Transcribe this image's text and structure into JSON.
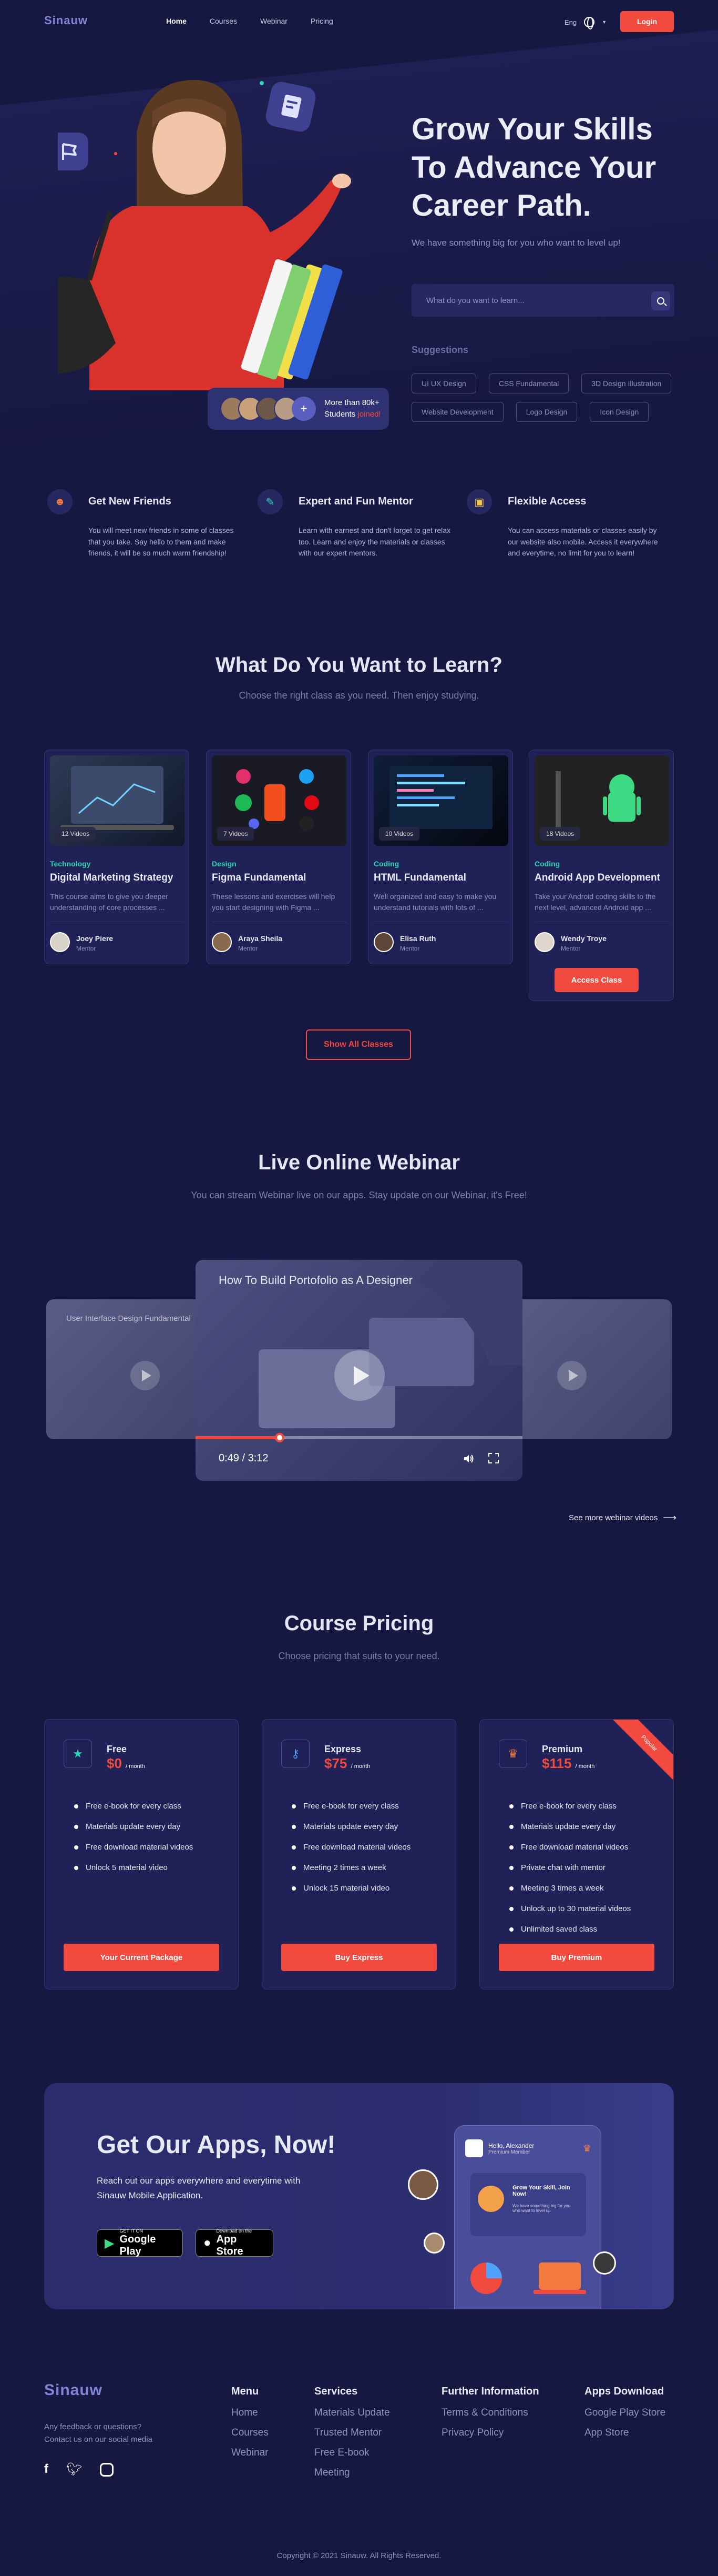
{
  "nav": {
    "logo": "Sinauw",
    "links": [
      {
        "label": "Home",
        "active": true
      },
      {
        "label": "Courses",
        "active": false
      },
      {
        "label": "Webinar",
        "active": false
      },
      {
        "label": "Pricing",
        "active": false
      }
    ],
    "lang": "Eng",
    "login_label": "Login"
  },
  "hero": {
    "title": "Grow Your Skills To Advance Your Career Path.",
    "subtitle": "We have something big for you who want to level up!",
    "search_placeholder": "What do you want to learn...",
    "suggestions_title": "Suggestions",
    "suggestions": [
      "UI UX Design",
      "CSS Fundamental",
      "3D Design Illustration",
      "Website Development",
      "Logo Design",
      "Icon Design"
    ],
    "students_text": "More than 80k+",
    "students_text2": "Students",
    "students_joined": "joined!",
    "students_plus": "+"
  },
  "features": [
    {
      "icon": "friends-icon",
      "title": "Get New Friends",
      "text": "You will meet new friends in some of classes that you take. Say hello to them and make friends, it will be so much warm friendship!"
    },
    {
      "icon": "mentor-icon",
      "title": "Expert and Fun Mentor",
      "text": "Learn with earnest and don't forget to get relax too. Learn and enjoy the materials or classes with our expert mentors."
    },
    {
      "icon": "access-icon",
      "title": "Flexible Access",
      "text": "You can access materials or classes easily by our website also mobile. Access it everywhere and everytime, no limit for you to learn!"
    }
  ],
  "learn": {
    "title": "What Do You Want to Learn?",
    "subtitle": "Choose the right class as you need. Then enjoy studying.",
    "courses": [
      {
        "videos": "12 Videos",
        "category": "Technology",
        "title": "Digital Marketing Strategy",
        "desc": "This course aims to give you deeper understanding of core processes ...",
        "mentor": "Joey Piere",
        "role": "Mentor"
      },
      {
        "videos": "7 Videos",
        "category": "Design",
        "title": "Figma Fundamental",
        "desc": "These lessons and exercises will help you start designing with Figma ...",
        "mentor": "Araya Sheila",
        "role": "Mentor"
      },
      {
        "videos": "10 Videos",
        "category": "Coding",
        "title": "HTML Fundamental",
        "desc": "Well organized and easy to make you understand tutorials with lots of ...",
        "mentor": "Elisa Ruth",
        "role": "Mentor"
      },
      {
        "videos": "18 Videos",
        "category": "Coding",
        "title": "Android App Development",
        "desc": "Take your Android coding skills to the next level, advanced Android app ...",
        "mentor": "Wendy Troye",
        "role": "Mentor",
        "action": "Access Class"
      }
    ],
    "show_all": "Show All Classes"
  },
  "webinar": {
    "title": "Live Online Webinar",
    "subtitle": "You can stream Webinar live on our apps. Stay update on our Webinar, it's Free!",
    "side_left_title": "User Interface Design Fundamental",
    "main_title": "How To Build Portofolio as A Designer",
    "time": "0:49 / 3:12",
    "progress": 0.257,
    "see_more": "See more webinar videos"
  },
  "pricing": {
    "title": "Course Pricing",
    "subtitle": "Choose pricing that suits to your need.",
    "plans": [
      {
        "name": "Free",
        "currency": "$",
        "price": "0",
        "period": "/ month",
        "icon": "star-icon",
        "features": [
          "Free e-book for every class",
          "Materials update every day",
          "Free download material videos",
          "Unlock 5 material video"
        ],
        "button": "Your Current Package"
      },
      {
        "name": "Express",
        "currency": "$",
        "price": "75",
        "period": "/ month",
        "icon": "key-icon",
        "features": [
          "Free e-book for every class",
          "Materials update every day",
          "Free download material videos",
          "Meeting 2 times a week",
          "Unlock 15 material video"
        ],
        "button": "Buy Express"
      },
      {
        "name": "Premium",
        "currency": "$",
        "price": "115",
        "period": "/ month",
        "icon": "crown-icon",
        "ribbon": "Popular",
        "features": [
          "Free e-book for every class",
          "Materials update every day",
          "Free download material videos",
          "Private chat with mentor",
          "Meeting 3 times a week",
          "Unlock up to 30 material videos",
          "Unlimited saved class"
        ],
        "button": "Buy Premium"
      }
    ]
  },
  "apps": {
    "title": "Get Our Apps, Now!",
    "subtitle": "Reach out our apps everywhere and everytime with Sinauw Mobile Application.",
    "google_small": "GET IT ON",
    "google_big": "Google Play",
    "apple_small": "Download on the",
    "apple_big": "App Store",
    "phone_user": "Hello, Alexander",
    "phone_role": "Premium Member",
    "phone_card_title": "Grow Your Skill, Join Now!",
    "phone_card_text": "We have something big for you who want to level up"
  },
  "footer": {
    "logo": "Sinauw",
    "contact_1": "Any feedback or questions?",
    "contact_2": "Contact us on our social media",
    "cols": [
      {
        "title": "Menu",
        "items": [
          "Home",
          "Courses",
          "Webinar"
        ]
      },
      {
        "title": "Services",
        "items": [
          "Materials Update",
          "Trusted Mentor",
          "Free E-book",
          "Meeting"
        ]
      },
      {
        "title": "Further Information",
        "items": [
          "Terms & Conditions",
          "Privacy Policy"
        ]
      },
      {
        "title": "Apps Download",
        "items": [
          "Google Play Store",
          "App Store"
        ]
      }
    ],
    "copyright": "Copyright © 2021 Sinauw. All Rights Reserved."
  },
  "colors": {
    "accent": "#f24a3f",
    "background": "#171841",
    "card": "#1f2157",
    "teal": "#2cd6b7"
  }
}
